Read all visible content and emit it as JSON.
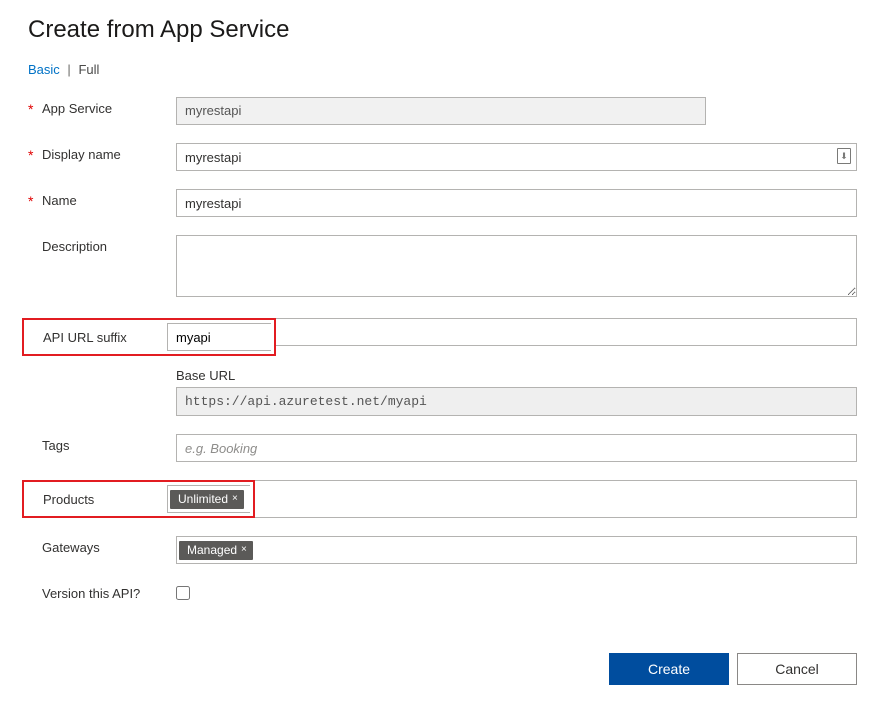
{
  "title": "Create from App Service",
  "tabs": {
    "basic": "Basic",
    "full": "Full",
    "sep": "|"
  },
  "fields": {
    "app_service": {
      "label": "App Service",
      "value": "myrestapi"
    },
    "display_name": {
      "label": "Display name",
      "value": "myrestapi"
    },
    "name": {
      "label": "Name",
      "value": "myrestapi"
    },
    "description": {
      "label": "Description",
      "value": ""
    },
    "api_url_suffix": {
      "label": "API URL suffix",
      "value": "myapi"
    },
    "base_url": {
      "label": "Base URL",
      "value": "https://api.azuretest.net/myapi"
    },
    "tags": {
      "label": "Tags",
      "placeholder": "e.g. Booking"
    },
    "products": {
      "label": "Products",
      "chip": "Unlimited"
    },
    "gateways": {
      "label": "Gateways",
      "chip": "Managed"
    },
    "version_api": {
      "label": "Version this API?"
    }
  },
  "buttons": {
    "create": "Create",
    "cancel": "Cancel"
  },
  "chip_x": "×",
  "save_icon": "⬇"
}
